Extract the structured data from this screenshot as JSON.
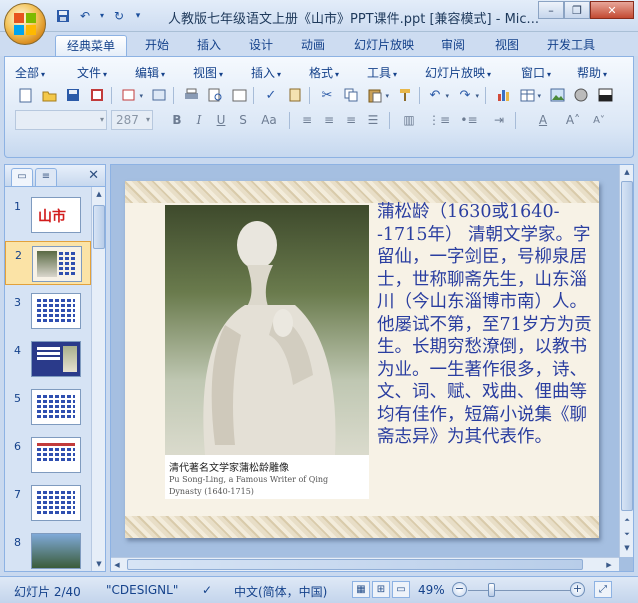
{
  "window": {
    "title": "人教版七年级语文上册《山市》PPT课件.ppt [兼容模式] - Mic..."
  },
  "quick_access": {
    "icons": [
      "save-icon",
      "undo-icon",
      "redo-icon"
    ]
  },
  "ribbon_tabs": [
    "经典菜单",
    "开始",
    "插入",
    "设计",
    "动画",
    "幻灯片放映",
    "审阅",
    "视图",
    "开发工具"
  ],
  "menus": [
    "全部",
    "文件",
    "编辑",
    "视图",
    "插入",
    "格式",
    "工具",
    "幻灯片放映",
    "窗口",
    "帮助"
  ],
  "font": {
    "name_value": "",
    "size_value": "287"
  },
  "slides_panel": {
    "thumbnails": [
      {
        "number": "1",
        "title": "山市"
      },
      {
        "number": "2"
      },
      {
        "number": "3"
      },
      {
        "number": "4"
      },
      {
        "number": "5"
      },
      {
        "number": "6"
      },
      {
        "number": "7"
      },
      {
        "number": "8"
      }
    ]
  },
  "slide": {
    "caption_line1": "清代著名文学家蒲松龄雕像",
    "caption_line2": "Pu Song-Ling, a Famous Writer of Qing",
    "caption_line3": "Dynasty (1640-1715)",
    "body_text": "蒲松龄（1630或1640--1715年） 清朝文学家。字留仙，一字剑臣，号柳泉居士，世称聊斋先生，山东淄川（今山东淄博市南）人。他屡试不第，至71岁方为贡生。长期穷愁潦倒，以教书为业。一生著作很多，诗、文、词、赋、戏曲、俚曲等均有佳作，短篇小说集《聊斋志异》为其代表作。"
  },
  "status": {
    "slide_indicator": "幻灯片 2/40",
    "theme": "\"CDESIGNL\"",
    "language": "中文(简体，中国)",
    "zoom": "49%"
  },
  "colors": {
    "accent": "#15428b",
    "body_text": "#2a3ea0",
    "title_red": "#d21c1c",
    "selected_thumb": "#fbe3a6"
  }
}
